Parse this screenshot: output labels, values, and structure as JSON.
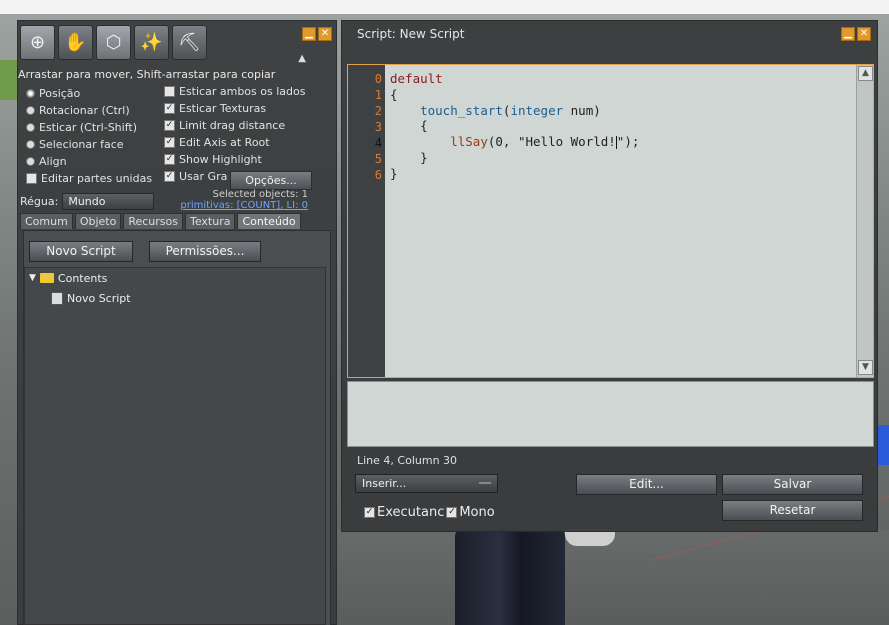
{
  "build": {
    "tools": [
      {
        "icon": "zoom-icon",
        "glyph": "⊕"
      },
      {
        "icon": "grab-icon",
        "glyph": "✋"
      },
      {
        "icon": "cube-select-icon",
        "glyph": "⬡"
      },
      {
        "icon": "magic-wand-icon",
        "glyph": "✨"
      },
      {
        "icon": "land-icon",
        "glyph": "⛏"
      }
    ],
    "hint": "Arrastar para mover, Shift-arrastar para copiar",
    "radio_options": [
      "Posição",
      "Rotacionar (Ctrl)",
      "Esticar (Ctrl-Shift)",
      "Selecionar face",
      "Align"
    ],
    "left_checkbox": "Editar partes unidas",
    "checkboxes": [
      {
        "label": "Esticar ambos os lados",
        "checked": false
      },
      {
        "label": "Esticar Texturas",
        "checked": true
      },
      {
        "label": "Limit drag distance",
        "checked": true
      },
      {
        "label": "Edit Axis at Root",
        "checked": true
      },
      {
        "label": "Show Highlight",
        "checked": true
      },
      {
        "label": "Usar Gra",
        "checked": true
      }
    ],
    "options_button": "Opções...",
    "ruler_label": "Régua:",
    "ruler_value": "Mundo",
    "selected_objects": "Selected objects: 1",
    "primitives": "primitivas: [COUNT], LI: 0",
    "tabs": [
      "Comum",
      "Objeto",
      "Recursos",
      "Textura",
      "Conteúdo"
    ],
    "active_tab": "Conteúdo",
    "new_script_button": "Novo Script",
    "permissions_button": "Permissões...",
    "tree": {
      "folder": "Contents",
      "item": "Novo Script"
    }
  },
  "editor": {
    "title": "Script: New Script",
    "line_numbers": [
      "0",
      "1",
      "2",
      "3",
      "4",
      "5",
      "6"
    ],
    "current_line_index": 4,
    "status": "Line 4, Column 30",
    "insert_select": "Inserir...",
    "edit_button": "Edit...",
    "save_button": "Salvar",
    "reset_button": "Resetar",
    "running_label": "Executanc",
    "mono_label": "Mono"
  },
  "colors": {
    "accent_orange": "#e39a2c",
    "panel_bg": "#373a3c",
    "code_bg": "#cfd6d4"
  }
}
